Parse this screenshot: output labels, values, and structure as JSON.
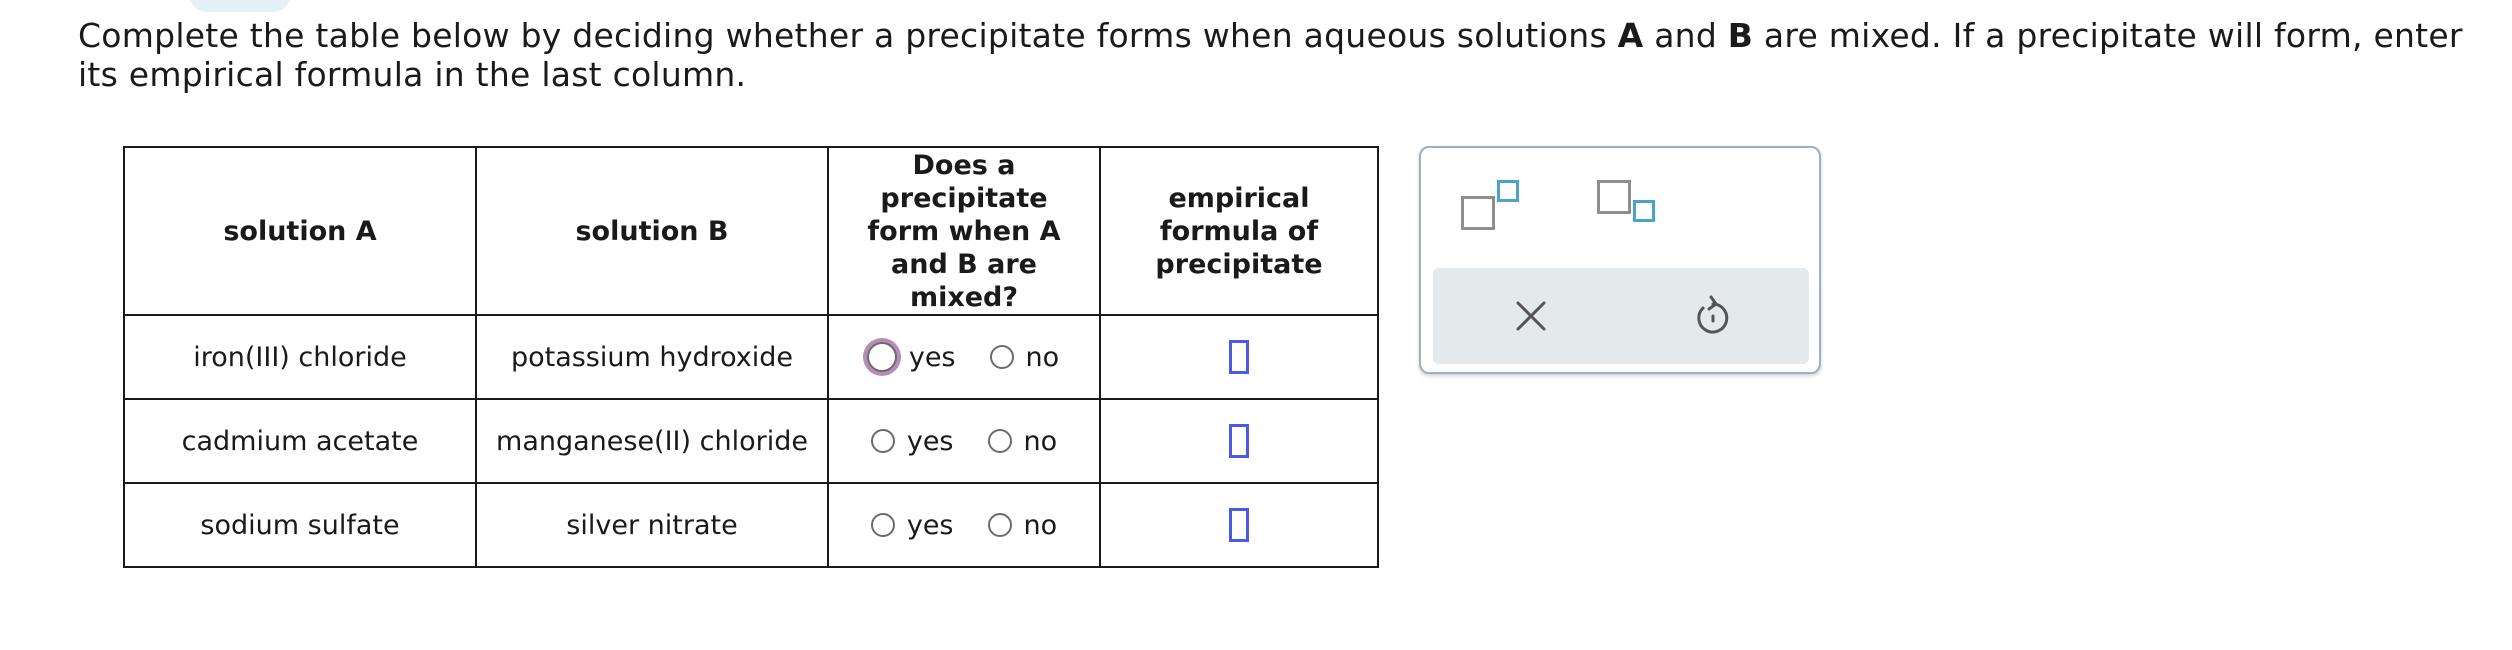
{
  "prompt": {
    "part1": "Complete the table below by deciding whether a precipitate forms when aqueous solutions ",
    "a": "A",
    "part2": " and ",
    "b": "B",
    "part3": " are mixed. If a precipitate will form, enter its empirical formula in the last column."
  },
  "table": {
    "headers": {
      "solution_a": "solution A",
      "solution_b": "solution B",
      "precipitate_question": "Does a precipitate form when A and B are mixed?",
      "empirical_formula": "empirical formula of precipitate"
    },
    "rows": [
      {
        "solution_a": "iron(III) chloride",
        "solution_b": "potassium hydroxide",
        "yes_label": "yes",
        "no_label": "no"
      },
      {
        "solution_a": "cadmium acetate",
        "solution_b": "manganese(II) chloride",
        "yes_label": "yes",
        "no_label": "no"
      },
      {
        "solution_a": "sodium sulfate",
        "solution_b": "silver nitrate",
        "yes_label": "yes",
        "no_label": "no"
      }
    ]
  },
  "tools": {
    "superscript_icon": "superscript-template-icon",
    "subscript_icon": "subscript-template-icon",
    "clear_icon": "close-icon",
    "undo_icon": "undo-icon"
  },
  "colors": {
    "answer_box": "#4a5be0",
    "focus_ring": "#b98bb9",
    "panel_border": "#9ab1c3",
    "template_small_square": "#4aa3c9",
    "action_bar": "#e4e9ec"
  }
}
